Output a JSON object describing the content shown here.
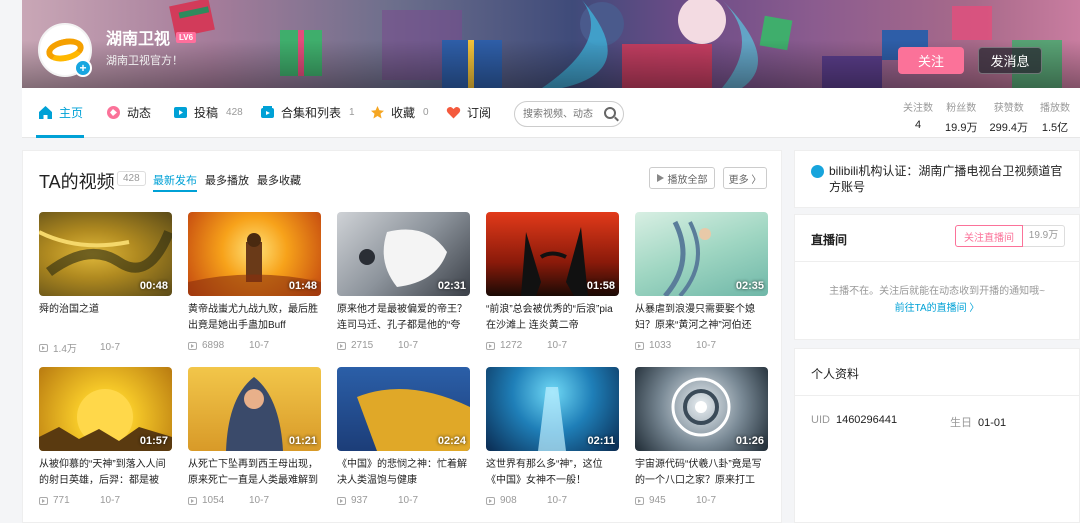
{
  "user": {
    "name": "湖南卫视",
    "level": "LV6",
    "sign": "湖南卫视官方！",
    "follow_label": "关注",
    "message_label": "发消息"
  },
  "nav": {
    "items": [
      {
        "label": "主页",
        "count": "",
        "icon": "home-icon",
        "color": "#00a1d6"
      },
      {
        "label": "动态",
        "count": "",
        "icon": "dynamic-icon",
        "color": "#fb7299"
      },
      {
        "label": "投稿",
        "count": "428",
        "icon": "upload-icon",
        "color": "#00a1d6"
      },
      {
        "label": "合集和列表",
        "count": "1",
        "icon": "collection-icon",
        "color": "#00a1d6"
      },
      {
        "label": "收藏",
        "count": "0",
        "icon": "star-icon",
        "color": "#f5a623"
      },
      {
        "label": "订阅",
        "count": "",
        "icon": "heart-icon",
        "color": "#f45a3d"
      }
    ],
    "search_placeholder": "搜索视频、动态",
    "stats": [
      {
        "label": "关注数",
        "value": "4"
      },
      {
        "label": "粉丝数",
        "value": "19.9万"
      },
      {
        "label": "获赞数",
        "value": "299.4万"
      },
      {
        "label": "播放数",
        "value": "1.5亿"
      }
    ]
  },
  "videos_section": {
    "title": "TA的视频",
    "count": "428",
    "sort_options": [
      "最新发布",
      "最多播放",
      "最多收藏"
    ],
    "play_all_label": "播放全部",
    "more_label": "更多 〉",
    "videos": [
      {
        "title": "舜的治国之道",
        "duration": "00:48",
        "plays": "1.4万",
        "date": "10-7"
      },
      {
        "title": "黄帝战蚩尤九战九败，最后胜出竟是她出手蛊加Buff",
        "duration": "01:48",
        "plays": "6898",
        "date": "10-7"
      },
      {
        "title": "原来他才是最被偏爱的帝王？连司马迁、孔子都是他的“夸",
        "duration": "02:31",
        "plays": "2715",
        "date": "10-7"
      },
      {
        "title": "“前浪”总会被优秀的“后浪”pia在沙滩上 连炎黄二帝",
        "duration": "01:58",
        "plays": "1272",
        "date": "10-7"
      },
      {
        "title": "从暴虐到浪漫只需要娶个媳妇？原来“黄河之神”河伯还",
        "duration": "02:35",
        "plays": "1033",
        "date": "10-7"
      },
      {
        "title": "从被仰慕的“天神”到落入人间的射日英雄，后羿：都是被",
        "duration": "01:57",
        "plays": "771",
        "date": "10-7"
      },
      {
        "title": "从死亡下坠再到西王母出现，原来死亡一直是人类最难解到",
        "duration": "01:21",
        "plays": "1054",
        "date": "10-7"
      },
      {
        "title": "《中国》的悲悯之神：忙着解决人类温饱与健康",
        "duration": "02:24",
        "plays": "937",
        "date": "10-7"
      },
      {
        "title": "这世界有那么多“神”，这位《中国》女神不一般！",
        "duration": "02:11",
        "plays": "908",
        "date": "10-7"
      },
      {
        "title": "宇宙源代码“伏羲八卦”竟是写的一个八口之家？原来打工",
        "duration": "01:26",
        "plays": "945",
        "date": "10-7"
      }
    ]
  },
  "certification": {
    "text": "bilibili机构认证：湖南广播电视台卫视频道官方账号"
  },
  "live": {
    "title": "直播间",
    "follow_label": "关注直播间",
    "count": "19.9万",
    "message": "主播不在。关注后就能在动态收到开播的通知哦~",
    "link": "前往TA的直播间 〉"
  },
  "profile": {
    "title": "个人资料",
    "uid_label": "UID",
    "uid": "1460296441",
    "birthday_label": "生日",
    "birthday": "01-01"
  }
}
